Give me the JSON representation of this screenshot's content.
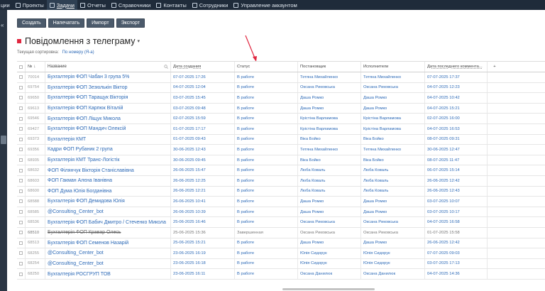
{
  "topnav": {
    "cut_label": "ции",
    "items": [
      {
        "label": "Проекты",
        "icon": "folder-icon"
      },
      {
        "label": "Задачи",
        "icon": "tasks-icon",
        "active": true
      },
      {
        "label": "Отчеты",
        "icon": "report-icon"
      },
      {
        "label": "Справочники",
        "icon": "book-icon"
      },
      {
        "label": "Контакты",
        "icon": "contacts-icon"
      },
      {
        "label": "Сотрудники",
        "icon": "employees-icon"
      },
      {
        "label": "Управление аккаунтом",
        "icon": "account-icon"
      }
    ]
  },
  "rail": {
    "toggle_icon": "«"
  },
  "toolbar": {
    "create_label": "Создать",
    "print_label": "Напечатать",
    "import_label": "Импорт",
    "export_label": "Экспорт"
  },
  "page": {
    "title": "Повідомлення з телеграму",
    "title_caret": "▾",
    "sort_label": "Текущая сортировка:",
    "sort_value": "По номеру (Я-а)",
    "accent_color": "#e0263f",
    "link_color": "#2d6ab7"
  },
  "table": {
    "headers": {
      "num": "№",
      "sort_arrow": "↓",
      "name": "Название",
      "date": "Дата создания",
      "status": "Статус",
      "author": "Постановщик",
      "executor": "Исполнители",
      "last": "Дата последнего коммента...",
      "add": "+"
    },
    "rows": [
      {
        "num": "70014",
        "name": "Бухгалтерія ФОП Чабан 3 група 5%",
        "date": "07-07-2025 17:26",
        "status": "В работе",
        "author": "Тетяна Михайленко",
        "executor": "Тетяна Михайленко",
        "last": "07-07-2025 17:37"
      },
      {
        "num": "69754",
        "name": "Бухгалтерія ФОП Зезюлькін Віктор",
        "date": "04-07-2025 12:04",
        "status": "В работе",
        "author": "Оксана Риковська",
        "executor": "Оксана Риковська",
        "last": "04-07-2025 12:23"
      },
      {
        "num": "69650",
        "name": "Бухгалтерія ФОП Таращук Вікторія",
        "date": "03-07-2025 15:45",
        "status": "В работе",
        "author": "Даша Ромко",
        "executor": "Даша Ромко",
        "last": "04-07-2025 10:42"
      },
      {
        "num": "69613",
        "name": "Бухгалтерія ФОП Карпюк Віталій",
        "date": "03-07-2025 09:48",
        "status": "В работе",
        "author": "Даша Ромко",
        "executor": "Даша Ромко",
        "last": "04-07-2025 15:21"
      },
      {
        "num": "69546",
        "name": "Бухгалтерія ФОП Ліщук Микола",
        "date": "02-07-2025 15:59",
        "status": "В работе",
        "author": "Крістіна Варламова",
        "executor": "Крістіна Варламова",
        "last": "02-07-2025 16:00"
      },
      {
        "num": "69427",
        "name": "Бухгалтерія ФОП Мандич Олексій",
        "date": "01-07-2025 17:17",
        "status": "В работе",
        "author": "Крістіна Варламова",
        "executor": "Крістіна Варламова",
        "last": "04-07-2025 16:53"
      },
      {
        "num": "69373",
        "name": "Бухгалтерія КМТ",
        "date": "01-07-2025 09:43",
        "status": "В работе",
        "author": "Віка Бойко",
        "executor": "Віка Бойко",
        "last": "08-07-2025 09:31"
      },
      {
        "num": "69356",
        "name": "Кадри ФОП Рубаник 2 група",
        "date": "30-06-2025 12:43",
        "status": "В работе",
        "author": "Тетяна Михайленко",
        "executor": "Тетяна Михайленко",
        "last": "30-06-2025 12:47"
      },
      {
        "num": "68935",
        "name": "Бухгалтерія КМТ Транс-Логістік",
        "date": "30-06-2025 09:45",
        "status": "В работе",
        "author": "Віка Бойко",
        "executor": "Віка Бойко",
        "last": "08-07-2025 11:47"
      },
      {
        "num": "68632",
        "name": "ФОП Філянчук Вікторія Станіславівна",
        "date": "26-06-2025 15:47",
        "status": "В работе",
        "author": "Люба Коваль",
        "executor": "Люба Коваль",
        "last": "06-07-2025 15:14"
      },
      {
        "num": "68603",
        "name": "ФОП Гакман Алєна Іванівна",
        "date": "26-06-2025 12:25",
        "status": "В работе",
        "author": "Люба Коваль",
        "executor": "Люба Коваль",
        "last": "26-06-2025 12:42"
      },
      {
        "num": "68600",
        "name": "ФОП Дума Юлія Богданівна",
        "date": "26-06-2025 12:21",
        "status": "В работе",
        "author": "Люба Коваль",
        "executor": "Люба Коваль",
        "last": "26-06-2025 12:43"
      },
      {
        "num": "68588",
        "name": "Бухгалтерія ФОП Демидова Юлія",
        "date": "26-06-2025 10:41",
        "status": "В работе",
        "author": "Даша Ромко",
        "executor": "Даша Ромко",
        "last": "03-07-2025 10:07"
      },
      {
        "num": "68585",
        "name": "@Consulting_Center_bot",
        "date": "26-06-2025 10:39",
        "status": "В работе",
        "author": "Даша Ромко",
        "executor": "Даша Ромко",
        "last": "03-07-2025 10:17"
      },
      {
        "num": "68536",
        "name": "Бухгалтерія ФОП Бабич Дмитро / Стеченко Микола",
        "date": "25-06-2025 16:46",
        "status": "В работе",
        "author": "Оксана Риковська",
        "executor": "Оксана Риковська",
        "last": "04-07-2025 16:58"
      },
      {
        "num": "68510",
        "name": "Бухгалтерія ФОП Кравар Олесь",
        "date": "25-06-2025 15:36",
        "status": "Завершенная",
        "author": "Оксана Риковська",
        "executor": "Оксана Риковська",
        "last": "01-07-2025 15:58",
        "struck": true
      },
      {
        "num": "68513",
        "name": "Бухгалтерія ФОП Семенов Назарій",
        "date": "25-06-2025 15:21",
        "status": "В работе",
        "author": "Даша Ромко",
        "executor": "Даша Ромко",
        "last": "26-06-2025 12:42"
      },
      {
        "num": "68255",
        "name": "@Consulting_Center_bot",
        "date": "23-06-2025 16:19",
        "status": "В работе",
        "author": "Юлія Сидорук",
        "executor": "Юлія Сидорук",
        "last": "07-07-2025 09:03"
      },
      {
        "num": "68254",
        "name": "@Consulting_Center_bot",
        "date": "23-06-2025 16:18",
        "status": "В работе",
        "author": "Юлія Сидорук",
        "executor": "Юлія Сидорук",
        "last": "03-07-2025 17:13"
      },
      {
        "num": "68250",
        "name": "Бухгалтерія РОСГРУП ТОВ",
        "date": "23-06-2025 16:11",
        "status": "В работе",
        "author": "Оксана Данилюк",
        "executor": "Оксана Данилюк",
        "last": "04-07-2025 14:36"
      }
    ]
  }
}
